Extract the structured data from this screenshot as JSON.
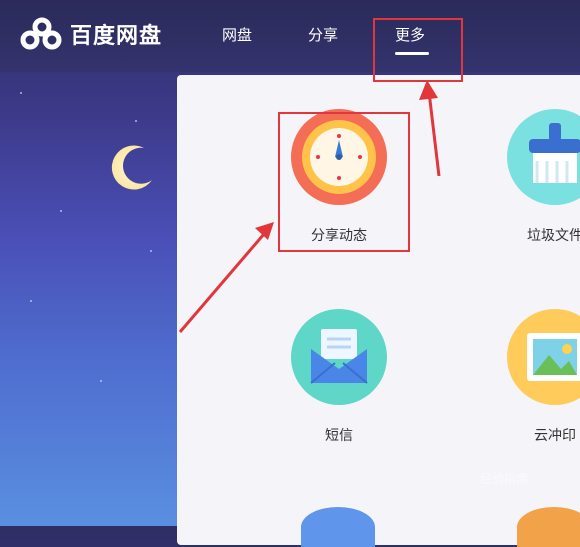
{
  "header": {
    "brand": "百度网盘",
    "nav": [
      {
        "label": "网盘"
      },
      {
        "label": "分享"
      },
      {
        "label": "更多"
      }
    ]
  },
  "apps": [
    {
      "label": "分享动态",
      "icon": "clock-icon",
      "color": "#f46d56"
    },
    {
      "label": "垃圾文件",
      "icon": "broom-icon",
      "color": "#7be0e0"
    },
    {
      "label": "短信",
      "icon": "envelope-icon",
      "color": "#5fd7c8"
    },
    {
      "label": "云冲印",
      "icon": "photo-icon",
      "color": "#ffcb5a"
    }
  ],
  "watermark": "经验指南",
  "colors": {
    "highlight": "#e0363c",
    "accent_red": "#e8383f"
  }
}
